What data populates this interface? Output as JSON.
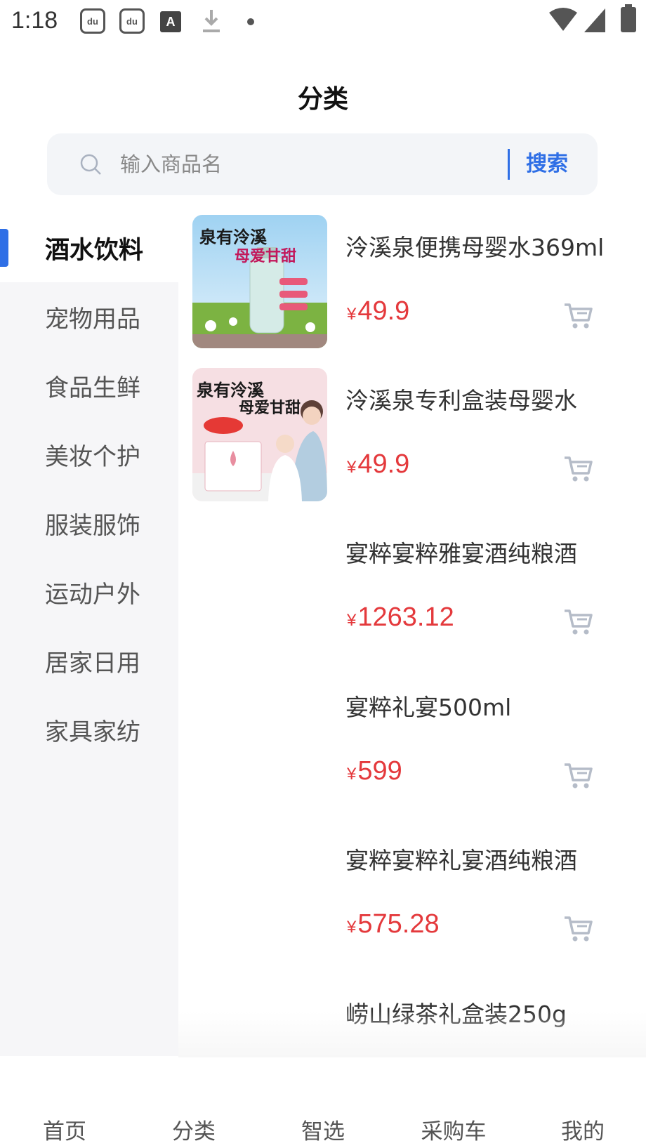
{
  "status_bar": {
    "time": "1:18",
    "icons": [
      "paw-icon",
      "paw-icon",
      "a-icon",
      "download-icon",
      "dot-icon",
      "wifi-icon",
      "signal-icon",
      "battery-icon"
    ],
    "paw_label": "du",
    "a_label": "A"
  },
  "header": {
    "title": "分类"
  },
  "search": {
    "placeholder": "输入商品名",
    "button_label": "搜索"
  },
  "sidebar": {
    "items": [
      {
        "label": "酒水饮料",
        "active": true
      },
      {
        "label": "宠物用品",
        "active": false
      },
      {
        "label": "食品生鲜",
        "active": false
      },
      {
        "label": "美妆个护",
        "active": false
      },
      {
        "label": "服装服饰",
        "active": false
      },
      {
        "label": "运动户外",
        "active": false
      },
      {
        "label": "居家日用",
        "active": false
      },
      {
        "label": "家具家纺",
        "active": false
      }
    ]
  },
  "products": [
    {
      "name": "泠溪泉便携母婴水369ml",
      "currency": "¥",
      "price": "49.9",
      "has_image": true,
      "image_text": {
        "headline1": "泉有泠溪",
        "headline2": "母爱甘甜"
      }
    },
    {
      "name": "泠溪泉专利盒装母婴水",
      "currency": "¥",
      "price": "49.9",
      "has_image": true,
      "image_text": {
        "headline1": "泉有泠溪",
        "headline2": "母爱甘甜"
      }
    },
    {
      "name": "宴粹宴粹雅宴酒纯粮酒",
      "currency": "¥",
      "price": "1263.12",
      "has_image": false
    },
    {
      "name": "宴粹礼宴500ml",
      "currency": "¥",
      "price": "599",
      "has_image": false
    },
    {
      "name": "宴粹宴粹礼宴酒纯粮酒",
      "currency": "¥",
      "price": "575.28",
      "has_image": false
    },
    {
      "name": "崂山绿茶礼盒装250g",
      "currency": "¥",
      "price": "",
      "has_image": false
    }
  ],
  "bottom_nav": {
    "items": [
      {
        "label": "首页"
      },
      {
        "label": "分类"
      },
      {
        "label": "智选"
      },
      {
        "label": "采购车"
      },
      {
        "label": "我的"
      }
    ]
  },
  "colors": {
    "accent": "#2f6fe6",
    "price": "#e4393c",
    "sidebar_bg": "#f6f6f8"
  }
}
